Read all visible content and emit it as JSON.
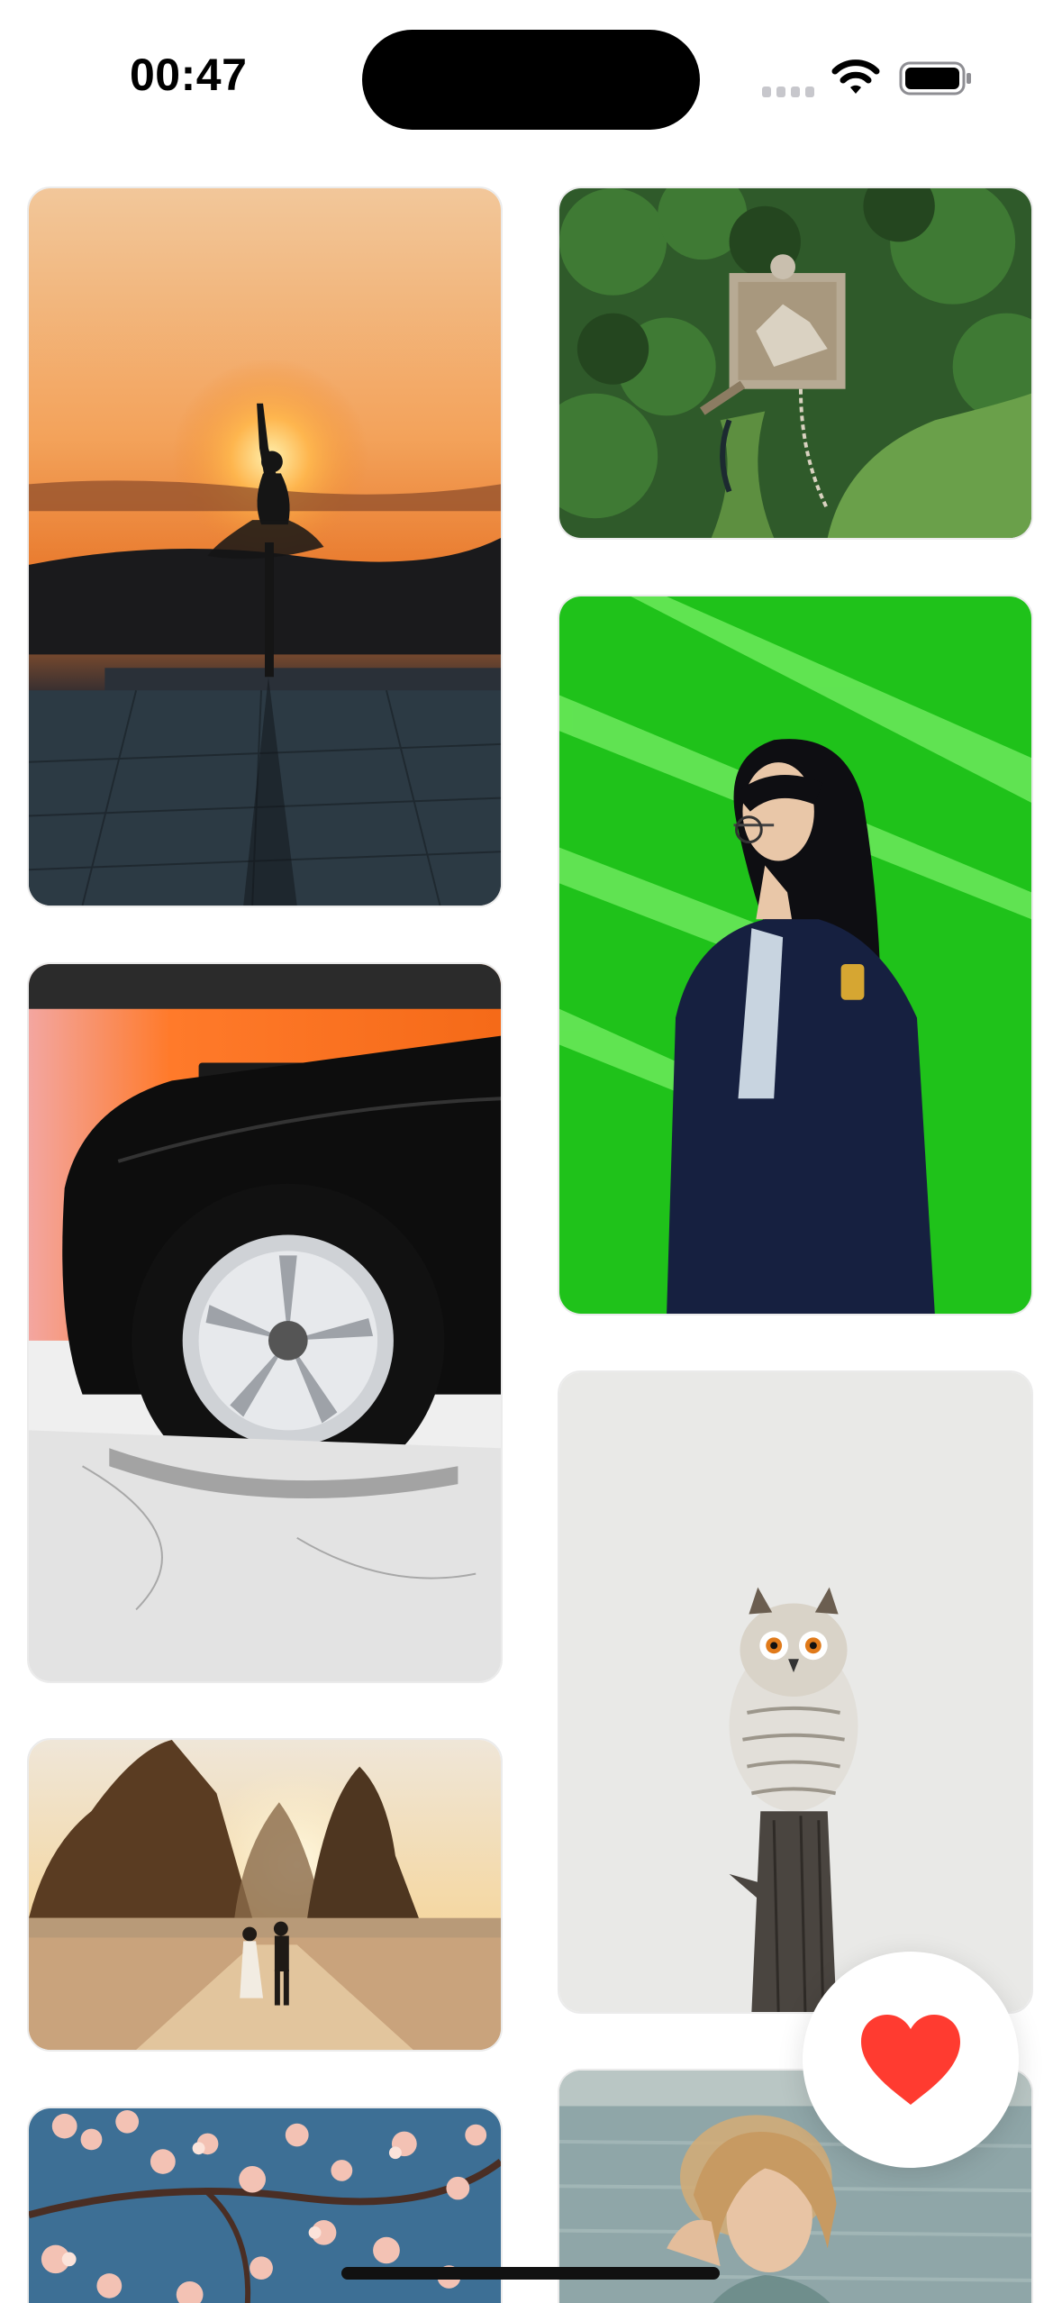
{
  "status_bar": {
    "time": "00:47",
    "wifi_icon": "wifi-icon",
    "battery_icon": "battery-icon",
    "signal_icon": "cellular-signal-icon"
  },
  "photos": [
    {
      "name": "photo-sunset-dancer",
      "column": "left"
    },
    {
      "name": "photo-aerial-jungle-statue",
      "column": "right"
    },
    {
      "name": "photo-woman-green-wall",
      "column": "right"
    },
    {
      "name": "photo-black-car-wheel",
      "column": "left"
    },
    {
      "name": "photo-owl-on-post",
      "column": "right"
    },
    {
      "name": "photo-couple-beach-rocks",
      "column": "left"
    },
    {
      "name": "photo-cherry-blossoms",
      "column": "left"
    },
    {
      "name": "photo-woman-by-sea",
      "column": "right"
    }
  ],
  "favorite_button": {
    "icon": "heart-icon",
    "color": "#ff3b30"
  }
}
